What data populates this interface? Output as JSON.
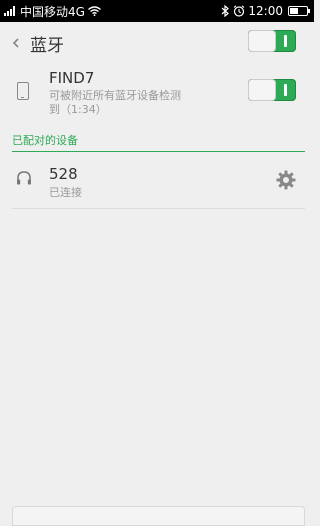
{
  "status_bar": {
    "carrier": "中国移动4G",
    "time": "12:00",
    "icons": [
      "signal-icon",
      "wifi-icon",
      "bluetooth-icon",
      "alarm-icon",
      "battery-icon"
    ]
  },
  "header": {
    "back_icon": "chevron-left-icon",
    "title": "蓝牙",
    "bluetooth_toggle": {
      "on": true
    }
  },
  "this_device": {
    "icon": "phone-icon",
    "name": "FIND7",
    "visibility_line1": "可被附近所有蓝牙设备检测",
    "visibility_line2": "到（1:34）",
    "visibility_toggle": {
      "on": true
    }
  },
  "paired_section": {
    "header": "已配对的设备",
    "devices": [
      {
        "icon": "headphones-icon",
        "name": "528",
        "status": "已连接",
        "settings_icon": "gear-icon"
      }
    ]
  },
  "colors": {
    "accent": "#2daa56",
    "background": "#efefef",
    "primary_text": "#333333",
    "secondary_text": "#999999"
  }
}
